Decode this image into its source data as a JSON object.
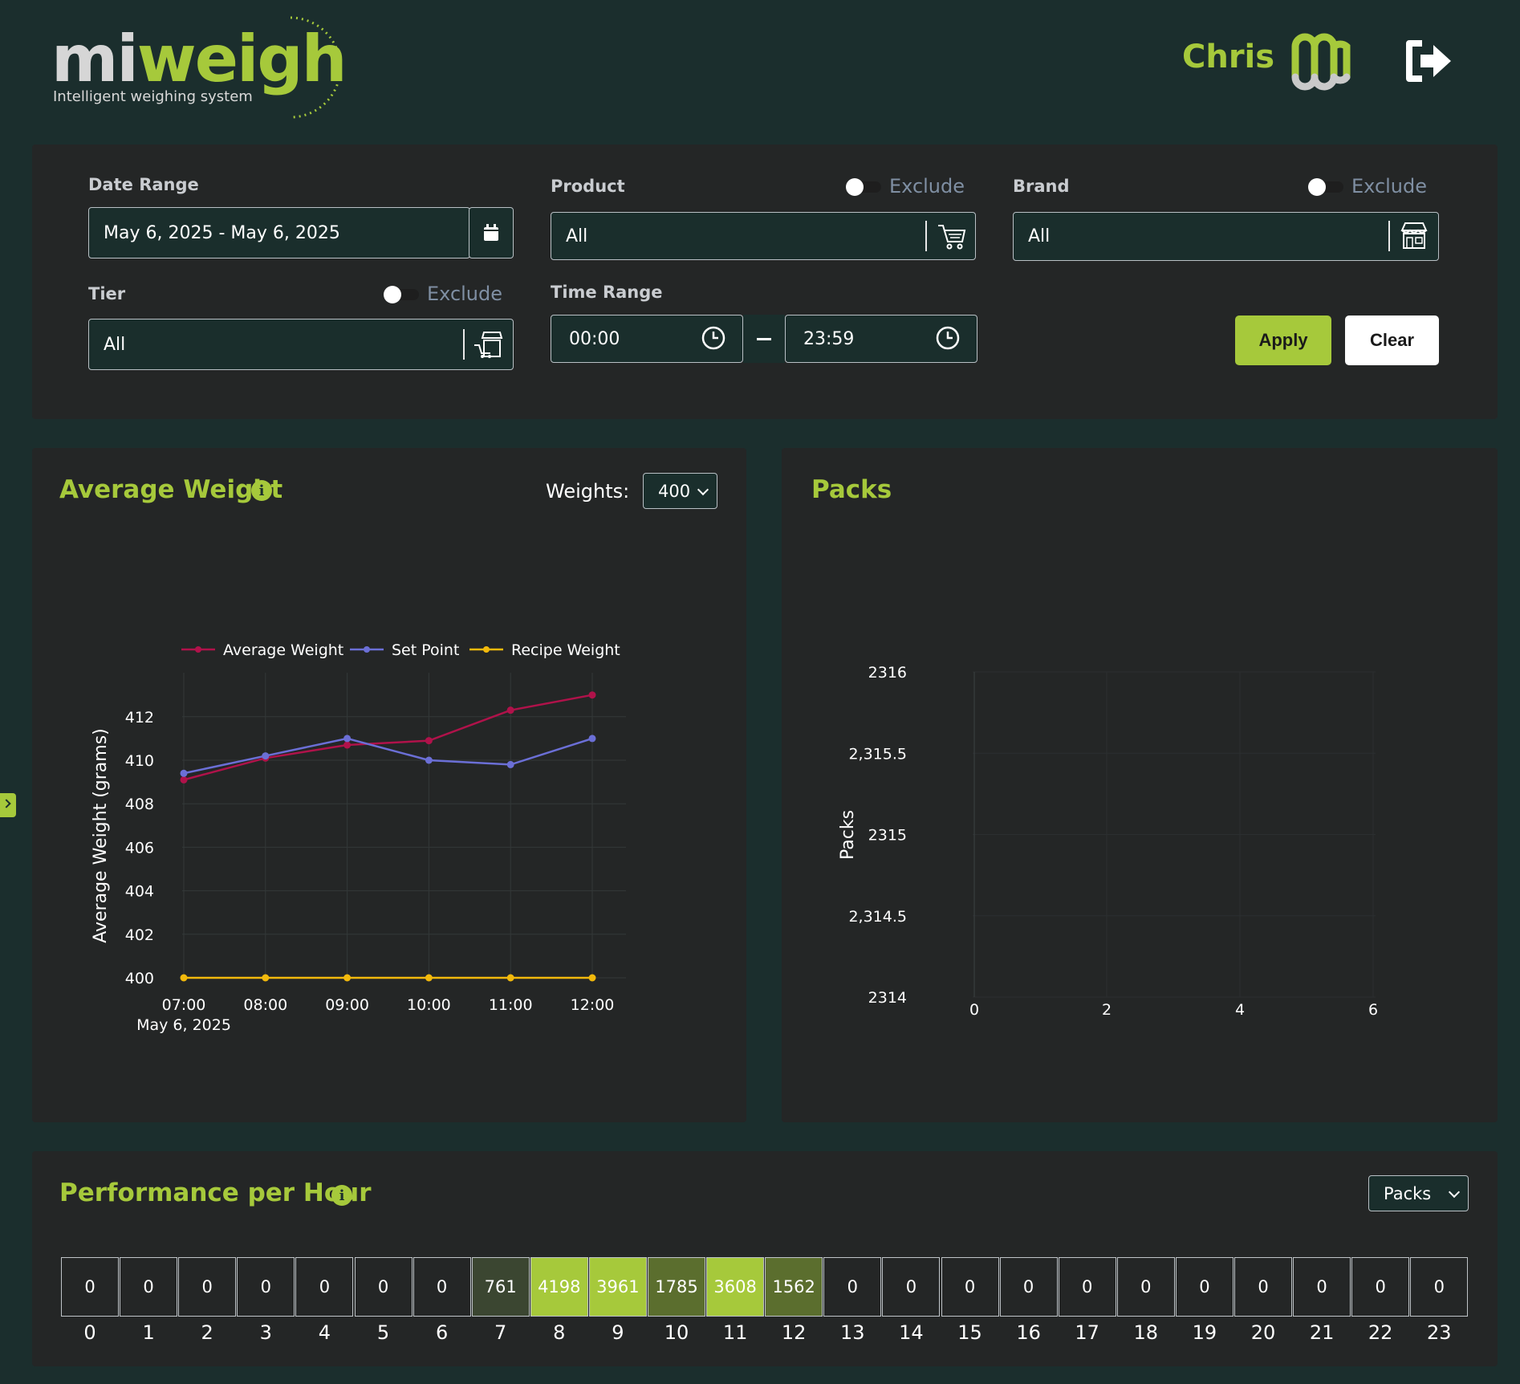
{
  "header": {
    "logo_text_a": "mi",
    "logo_text_b": "weigh",
    "tagline": "Intelligent weighing system",
    "user_name": "Chris"
  },
  "filters": {
    "date_range": {
      "label": "Date Range",
      "value": "May 6, 2025 - May 6, 2025"
    },
    "product": {
      "label": "Product",
      "value": "All",
      "exclude_label": "Exclude"
    },
    "brand": {
      "label": "Brand",
      "value": "All",
      "exclude_label": "Exclude"
    },
    "tier": {
      "label": "Tier",
      "value": "All",
      "exclude_label": "Exclude"
    },
    "time_range": {
      "label": "Time Range",
      "start": "00:00",
      "end": "23:59"
    },
    "apply_label": "Apply",
    "clear_label": "Clear"
  },
  "avg_weight": {
    "title": "Average Weight",
    "weights_label": "Weights:",
    "weights_value": "400"
  },
  "packs": {
    "title": "Packs"
  },
  "performance": {
    "title": "Performance per Hour",
    "select_value": "Packs"
  },
  "chart_data": [
    {
      "type": "line",
      "title": "",
      "xlabel": "",
      "ylabel": "Average Weight (grams)",
      "categories": [
        "07:00",
        "08:00",
        "09:00",
        "10:00",
        "11:00",
        "12:00"
      ],
      "x_sublabel": "May 6, 2025",
      "ylim": [
        400,
        414
      ],
      "yticks": [
        400,
        402,
        404,
        406,
        408,
        410,
        412
      ],
      "legend": "top",
      "series": [
        {
          "name": "Average Weight",
          "color": "#b0124a",
          "values": [
            409.1,
            410.1,
            410.7,
            410.9,
            412.3,
            413.0
          ]
        },
        {
          "name": "Set Point",
          "color": "#6b6fd6",
          "values": [
            409.4,
            410.2,
            411.0,
            410.0,
            409.8,
            411.0
          ]
        },
        {
          "name": "Recipe Weight",
          "color": "#f2b90c",
          "values": [
            400,
            400,
            400,
            400,
            400,
            400
          ]
        }
      ]
    },
    {
      "type": "scatter",
      "title": "",
      "xlabel": "",
      "ylabel": "Packs",
      "xlim": [
        -0.3,
        7.3
      ],
      "xticks": [
        "0",
        "2",
        "4",
        "6"
      ],
      "ylim": [
        2314,
        2316
      ],
      "yticks": [
        "2314",
        "2,314.5",
        "2315",
        "2,315.5",
        "2316"
      ],
      "series": []
    },
    {
      "type": "heatmap",
      "hours": [
        "0",
        "1",
        "2",
        "3",
        "4",
        "5",
        "6",
        "7",
        "8",
        "9",
        "10",
        "11",
        "12",
        "13",
        "14",
        "15",
        "16",
        "17",
        "18",
        "19",
        "20",
        "21",
        "22",
        "23"
      ],
      "values": [
        0,
        0,
        0,
        0,
        0,
        0,
        0,
        761,
        4198,
        3961,
        1785,
        3608,
        1562,
        0,
        0,
        0,
        0,
        0,
        0,
        0,
        0,
        0,
        0,
        0
      ]
    }
  ]
}
